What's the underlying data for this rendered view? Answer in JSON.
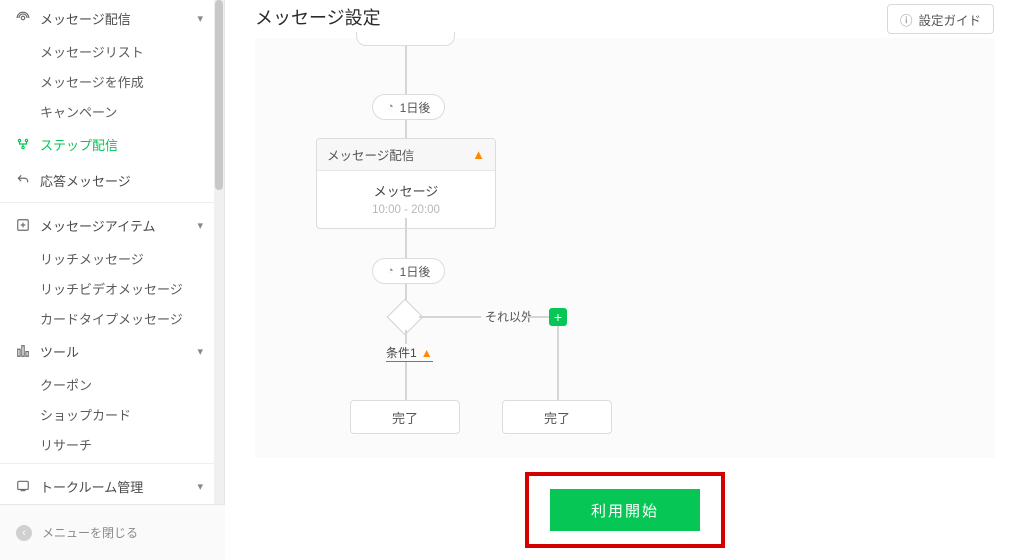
{
  "sidebar": {
    "groups": [
      {
        "label": "メッセージ配信",
        "items": [
          "メッセージリスト",
          "メッセージを作成",
          "キャンペーン"
        ]
      }
    ],
    "step": "ステップ配信",
    "reply": "応答メッセージ",
    "items_group": {
      "label": "メッセージアイテム",
      "items": [
        "リッチメッセージ",
        "リッチビデオメッセージ",
        "カードタイプメッセージ"
      ]
    },
    "tools_group": {
      "label": "ツール",
      "items": [
        "クーポン",
        "ショップカード",
        "リサーチ"
      ]
    },
    "talkroom": "トークルーム管理",
    "footer": "メニューを閉じる"
  },
  "header": {
    "title": "メッセージ設定",
    "guide": "設定ガイド"
  },
  "flow": {
    "delay1": "1日後",
    "card_head": "メッセージ配信",
    "card_title": "メッセージ",
    "card_time": "10:00 - 20:00",
    "delay2": "1日後",
    "else": "それ以外",
    "cond": "条件1",
    "end": "完了"
  },
  "cta": "利用開始"
}
